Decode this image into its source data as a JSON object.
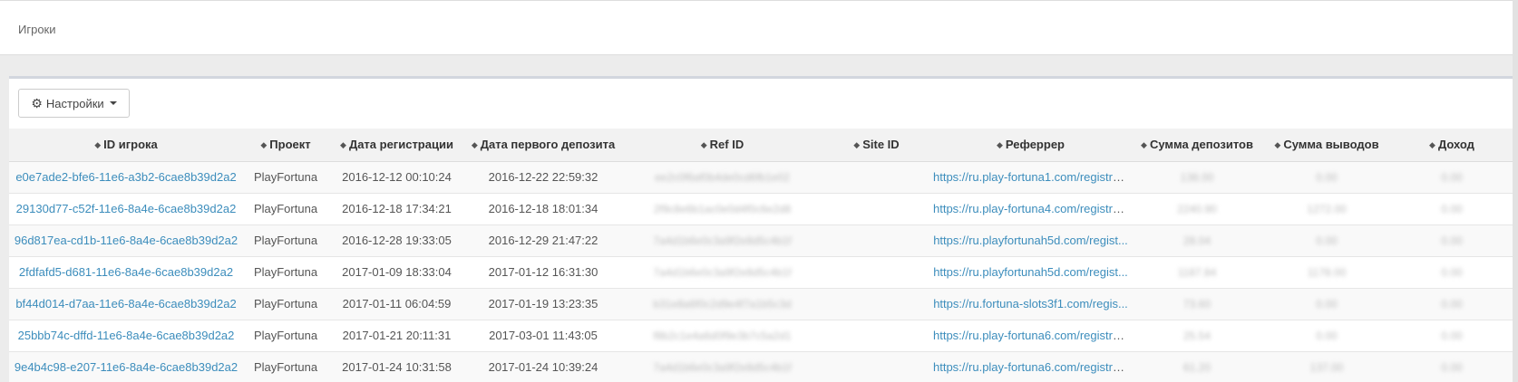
{
  "header": {
    "title": "Игроки"
  },
  "toolbar": {
    "settings_label": "Настройки"
  },
  "table": {
    "columns": [
      "ID игрока",
      "Проект",
      "Дата регистрации",
      "Дата первого депозита",
      "Ref ID",
      "Site ID",
      "Реферрер",
      "Сумма депозитов",
      "Сумма выводов",
      "Доход"
    ],
    "rows": [
      {
        "id": "e0e7ade2-bfe6-11e6-a3b2-6cae8b39d2a2",
        "project": "PlayFortuna",
        "reg": "2016-12-12 00:10:24",
        "dep": "2016-12-22 22:59:32",
        "ref": "ee2c0f6af0b4de0cd6fb1e02",
        "site": "",
        "referrer": "https://ru.play-fortuna1.com/registra...",
        "deposits": "138.00",
        "withdrawals": "0.00",
        "income": "0.00"
      },
      {
        "id": "29130d77-c52f-11e6-8a4e-6cae8b39d2a2",
        "project": "PlayFortuna",
        "reg": "2016-12-18 17:34:21",
        "dep": "2016-12-18 18:01:34",
        "ref": "2f9c8e6b1ac0e0d4f0c6e2d8",
        "site": "",
        "referrer": "https://ru.play-fortuna4.com/registra...",
        "deposits": "2240.90",
        "withdrawals": "1272.00",
        "income": "0.00"
      },
      {
        "id": "96d817ea-cd1b-11e6-8a4e-6cae8b39d2a2",
        "project": "PlayFortuna",
        "reg": "2016-12-28 19:33:05",
        "dep": "2016-12-29 21:47:22",
        "ref": "7a4d1b6e0c3a9f2e8d5c4b1f",
        "site": "",
        "referrer": "https://ru.playfortunah5d.com/regist...",
        "deposits": "28.04",
        "withdrawals": "0.00",
        "income": "0.00"
      },
      {
        "id": "2fdfafd5-d681-11e6-8a4e-6cae8b39d2a2",
        "project": "PlayFortuna",
        "reg": "2017-01-09 18:33:04",
        "dep": "2017-01-12 16:31:30",
        "ref": "7a4d1b6e0c3a9f2e8d5c4b1f",
        "site": "",
        "referrer": "https://ru.playfortunah5d.com/regist...",
        "deposits": "1187.84",
        "withdrawals": "1178.00",
        "income": "0.00"
      },
      {
        "id": "bf44d014-d7aa-11e6-8a4e-6cae8b39d2a2",
        "project": "PlayFortuna",
        "reg": "2017-01-11 06:04:59",
        "dep": "2017-01-19 13:23:35",
        "ref": "b31e8a6f0c2d9e4f7a1b5c3d",
        "site": "",
        "referrer": "https://ru.fortuna-slots3f1.com/regis...",
        "deposits": "73.60",
        "withdrawals": "0.00",
        "income": "0.00"
      },
      {
        "id": "25bbb74c-dffd-11e6-8a4e-6cae8b39d2a2",
        "project": "PlayFortuna",
        "reg": "2017-01-21 20:11:31",
        "dep": "2017-03-01 11:43:05",
        "ref": "f8b2c1e4a6d0f9e3b7c5a2d1",
        "site": "",
        "referrer": "https://ru.play-fortuna6.com/registra...",
        "deposits": "25.54",
        "withdrawals": "0.00",
        "income": "0.00"
      },
      {
        "id": "9e4b4c98-e207-11e6-8a4e-6cae8b39d2a2",
        "project": "PlayFortuna",
        "reg": "2017-01-24 10:31:58",
        "dep": "2017-01-24 10:39:24",
        "ref": "7a4d1b6e0c3a9f2e8d5c4b1f",
        "site": "",
        "referrer": "https://ru.play-fortuna6.com/registra...",
        "deposits": "61.20",
        "withdrawals": "137.00",
        "income": "0.00"
      }
    ]
  },
  "icons": {
    "settings": "gear-icon",
    "dropdown": "caret-down-icon",
    "sort": "sort-icon"
  },
  "colors": {
    "link": "#3c8dbc",
    "header_bg": "#f2f2f2"
  }
}
